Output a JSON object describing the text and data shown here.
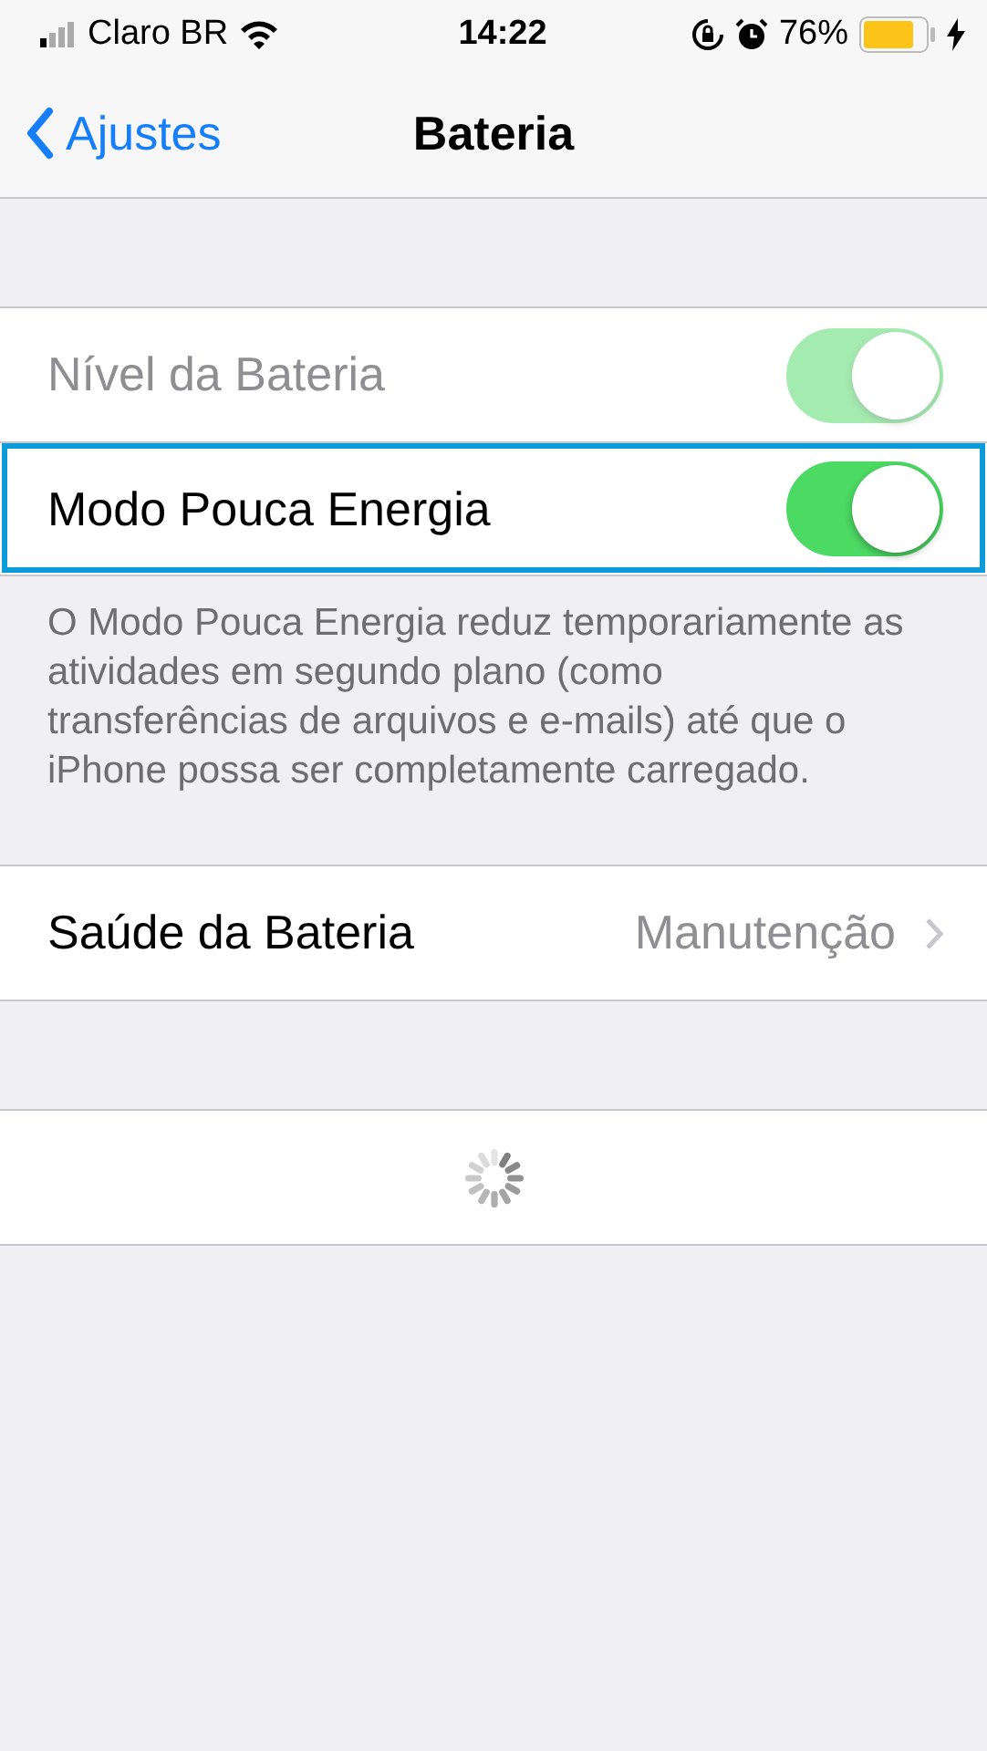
{
  "status_bar": {
    "carrier": "Claro BR",
    "time": "14:22",
    "battery_percent": "76%"
  },
  "nav": {
    "back": "Ajustes",
    "title": "Bateria"
  },
  "toggles": [
    {
      "label": "Nível da Bateria",
      "on": true,
      "disabled": true,
      "highlighted": false
    },
    {
      "label": "Modo Pouca Energia",
      "on": true,
      "disabled": false,
      "highlighted": true
    }
  ],
  "footer_note": "O Modo Pouca Energia reduz temporariamente as atividades em segundo plano (como transferências de arquivos e e-mails) até que o iPhone possa ser completamente carregado.",
  "health": {
    "label": "Saúde da Bateria",
    "value": "Manutenção"
  }
}
